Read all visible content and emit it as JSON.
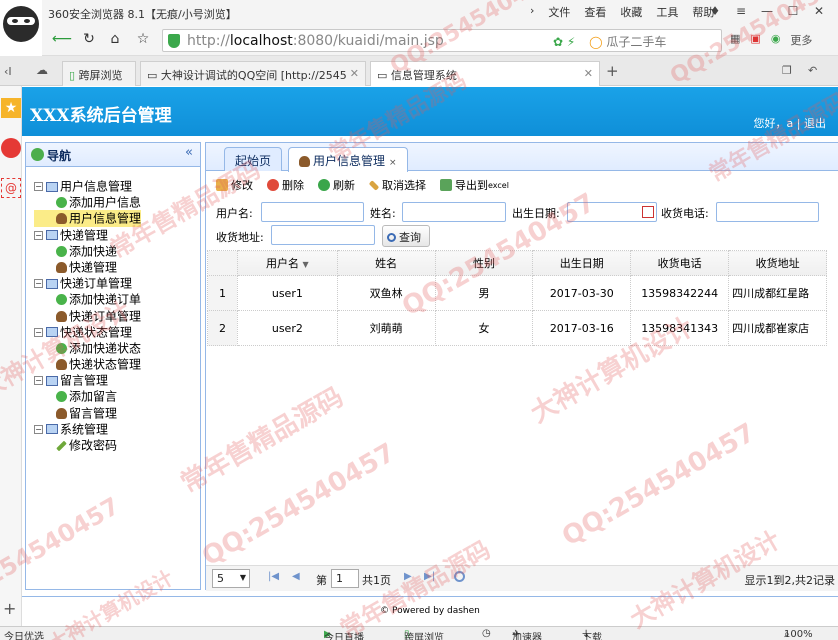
{
  "browser": {
    "title": "360安全浏览器 8.1【无痕/小号浏览】",
    "menus": [
      "文件",
      "查看",
      "收藏",
      "工具",
      "帮助"
    ],
    "url_host": "http://",
    "url_main": "localhost",
    "url_rest": ":8080/kuaidi/main.jsp",
    "search_hint": "瓜子二手车",
    "more_label": "更多",
    "tabs": [
      {
        "label": "跨屏浏览"
      },
      {
        "label": "大神设计调试的QQ空间 [http://2545"
      },
      {
        "label": "信息管理系统"
      }
    ]
  },
  "app": {
    "title": "XXX系统后台管理",
    "user_greeting": "您好，a",
    "logout": "退出"
  },
  "nav": {
    "title": "导航",
    "collapse": "«",
    "groups": [
      {
        "label": "用户信息管理",
        "children": [
          {
            "label": "添加用户信息",
            "icon": "add-icon"
          },
          {
            "label": "用户信息管理",
            "icon": "user-icon",
            "selected": true
          }
        ]
      },
      {
        "label": "快递管理",
        "children": [
          {
            "label": "添加快递",
            "icon": "add-icon"
          },
          {
            "label": "快递管理",
            "icon": "user-icon"
          }
        ]
      },
      {
        "label": "快递订单管理",
        "children": [
          {
            "label": "添加快递订单",
            "icon": "add-icon"
          },
          {
            "label": "快递订单管理",
            "icon": "user-icon"
          }
        ]
      },
      {
        "label": "快递状态管理",
        "children": [
          {
            "label": "添加快递状态",
            "icon": "add-icon"
          },
          {
            "label": "快递状态管理",
            "icon": "user-icon"
          }
        ]
      },
      {
        "label": "留言管理",
        "children": [
          {
            "label": "添加留言",
            "icon": "add-icon"
          },
          {
            "label": "留言管理",
            "icon": "user-icon"
          }
        ]
      },
      {
        "label": "系统管理",
        "children": [
          {
            "label": "修改密码",
            "icon": "pencil-icon"
          }
        ]
      }
    ]
  },
  "tabs": [
    {
      "label": "起始页"
    },
    {
      "label": "用户信息管理",
      "close": "×"
    }
  ],
  "toolbar": {
    "edit": "修改",
    "delete": "删除",
    "refresh": "刷新",
    "cancel_select": "取消选择",
    "export_prefix": "导出到",
    "export_suffix": "excel"
  },
  "filters": {
    "username": "用户名:",
    "name": "姓名:",
    "birthday": "出生日期:",
    "phone": "收货电话:",
    "address": "收货地址:",
    "query": "查询"
  },
  "grid": {
    "columns": [
      "用户名",
      "姓名",
      "性别",
      "出生日期",
      "收货电话",
      "收货地址"
    ],
    "sort_indicator": "▼",
    "rows": [
      {
        "num": "1",
        "username": "user1",
        "name": "双鱼林",
        "gender": "男",
        "birthday": "2017-03-30",
        "phone": "13598342244",
        "address": "四川成都红星路"
      },
      {
        "num": "2",
        "username": "user2",
        "name": "刘萌萌",
        "gender": "女",
        "birthday": "2017-03-16",
        "phone": "13598341343",
        "address": "四川成都崔家店"
      }
    ]
  },
  "pager": {
    "page_size": "5",
    "page_prefix": "第",
    "page_value": "1",
    "total_pages": "共1页",
    "info": "显示1到2,共2记录"
  },
  "footer": "© Powered by dashen",
  "status": {
    "left": "今日优选",
    "items": [
      "今日直播",
      "跨屏浏览",
      "加速器",
      "下载"
    ],
    "zoom": "100%"
  },
  "watermark": {
    "qq": "QQ:254540457",
    "a": "大神计算机设计",
    "b": "常年售精品源码"
  }
}
